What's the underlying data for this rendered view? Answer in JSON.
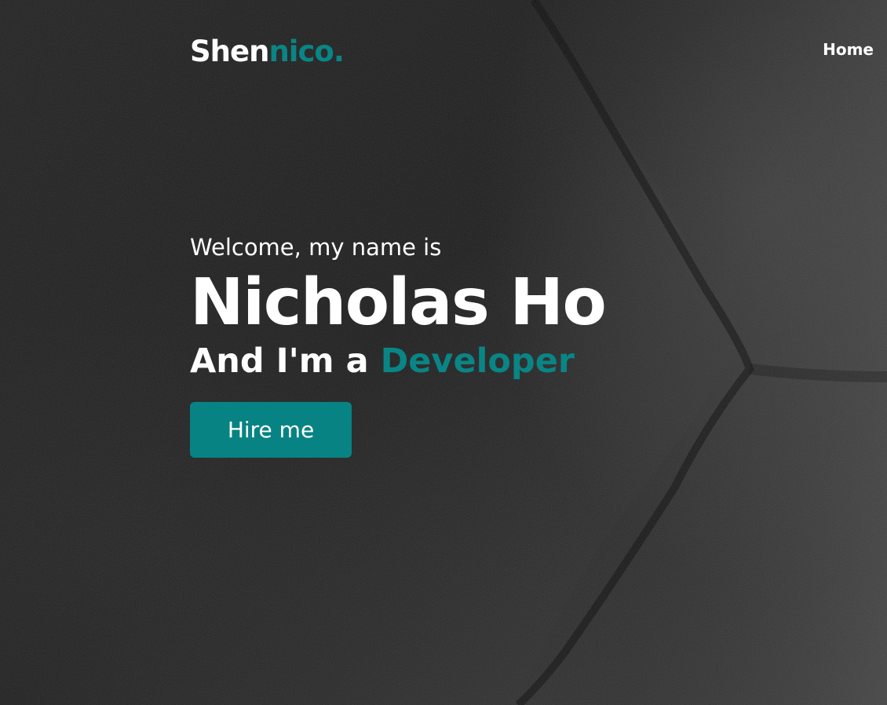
{
  "logo": {
    "main": "Shen",
    "accent": "nico."
  },
  "nav": {
    "home_label": "Home"
  },
  "hero": {
    "welcome": "Welcome, my name is",
    "name": "Nicholas Ho",
    "role_prefix": "And I'm a ",
    "role": "Developer",
    "cta_label": "Hire me"
  },
  "colors": {
    "accent": "#098585",
    "text": "#ffffff",
    "background": "#1e1e1e"
  }
}
